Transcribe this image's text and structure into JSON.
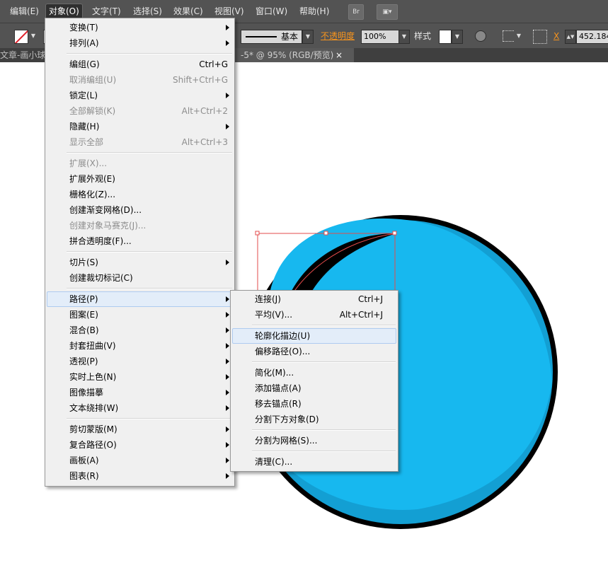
{
  "menubar": {
    "items": [
      "编辑(E)",
      "对象(O)",
      "文字(T)",
      "选择(S)",
      "效果(C)",
      "视图(V)",
      "窗口(W)",
      "帮助(H)"
    ],
    "bridge_icon": "Br"
  },
  "toolbar": {
    "stroke_style": "基本",
    "opacity_label": "不透明度",
    "opacity_value": "100%",
    "style_label": "样式",
    "x_label": "X",
    "x_value": "452.184"
  },
  "tabs": {
    "doc_left": "文章-画小球",
    "doc_title": "-5* @ 95% (RGB/预览)",
    "close": "×"
  },
  "object_menu": {
    "groups": [
      [
        {
          "label": "变换(T)",
          "submenu": true
        },
        {
          "label": "排列(A)",
          "submenu": true
        }
      ],
      [
        {
          "label": "编组(G)",
          "shortcut": "Ctrl+G"
        },
        {
          "label": "取消编组(U)",
          "shortcut": "Shift+Ctrl+G",
          "disabled": true
        },
        {
          "label": "锁定(L)",
          "submenu": true
        },
        {
          "label": "全部解锁(K)",
          "shortcut": "Alt+Ctrl+2",
          "disabled": true
        },
        {
          "label": "隐藏(H)",
          "submenu": true
        },
        {
          "label": "显示全部",
          "shortcut": "Alt+Ctrl+3",
          "disabled": true
        }
      ],
      [
        {
          "label": "扩展(X)...",
          "disabled": true
        },
        {
          "label": "扩展外观(E)"
        },
        {
          "label": "栅格化(Z)..."
        },
        {
          "label": "创建渐变网格(D)..."
        },
        {
          "label": "创建对象马赛克(J)...",
          "disabled": true
        },
        {
          "label": "拼合透明度(F)..."
        }
      ],
      [
        {
          "label": "切片(S)",
          "submenu": true
        },
        {
          "label": "创建裁切标记(C)"
        }
      ],
      [
        {
          "label": "路径(P)",
          "submenu": true,
          "highlighted": true
        },
        {
          "label": "图案(E)",
          "submenu": true
        },
        {
          "label": "混合(B)",
          "submenu": true
        },
        {
          "label": "封套扭曲(V)",
          "submenu": true
        },
        {
          "label": "透视(P)",
          "submenu": true
        },
        {
          "label": "实时上色(N)",
          "submenu": true
        },
        {
          "label": "图像描摹",
          "submenu": true
        },
        {
          "label": "文本绕排(W)",
          "submenu": true
        }
      ],
      [
        {
          "label": "剪切蒙版(M)",
          "submenu": true
        },
        {
          "label": "复合路径(O)",
          "submenu": true
        },
        {
          "label": "画板(A)",
          "submenu": true
        },
        {
          "label": "图表(R)",
          "submenu": true
        }
      ]
    ]
  },
  "path_submenu": {
    "groups": [
      [
        {
          "label": "连接(J)",
          "shortcut": "Ctrl+J"
        },
        {
          "label": "平均(V)...",
          "shortcut": "Alt+Ctrl+J"
        }
      ],
      [
        {
          "label": "轮廓化描边(U)",
          "highlighted": true
        },
        {
          "label": "偏移路径(O)..."
        }
      ],
      [
        {
          "label": "简化(M)..."
        },
        {
          "label": "添加锚点(A)"
        },
        {
          "label": "移去锚点(R)"
        },
        {
          "label": "分割下方对象(D)"
        }
      ],
      [
        {
          "label": "分割为网格(S)..."
        }
      ],
      [
        {
          "label": "清理(C)..."
        }
      ]
    ]
  },
  "colors": {
    "ball_fill": "#17b8ef",
    "ball_shade": "#139fd3",
    "outline": "#000000",
    "selection": "#e34b4b"
  }
}
